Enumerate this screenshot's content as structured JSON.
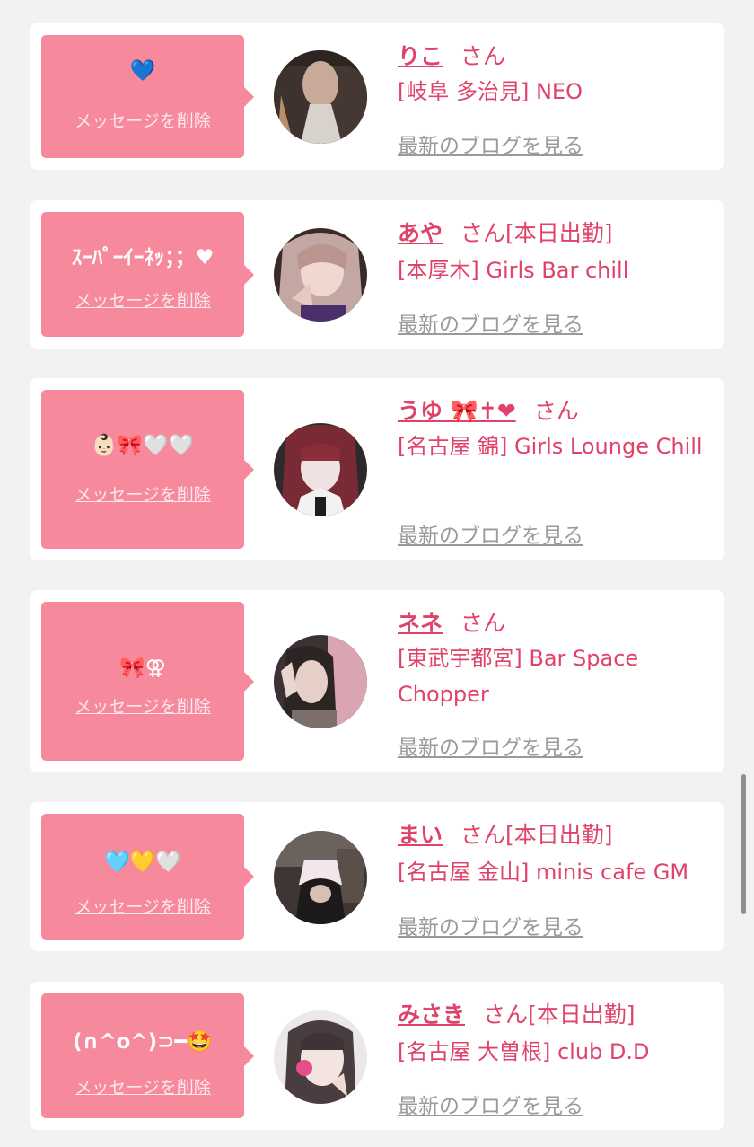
{
  "delete_label": "メッセージを削除",
  "blog_label": "最新のブログを見る",
  "honorific": "さん",
  "items": [
    {
      "name": "りこ",
      "tag": "",
      "message": "💙",
      "shop": "[岐阜 多治見] NEO"
    },
    {
      "name": "あや",
      "tag": "[本日出勤]",
      "message": "ｽｰﾊﾟｰｲｰﾈｯ；；♥",
      "shop": "[本厚木] Girls Bar chill"
    },
    {
      "name": "うゆ 🎀✝❤",
      "tag": "",
      "message": "👶🏻🎀🤍🤍",
      "shop": "[名古屋 錦] Girls Lounge Chill"
    },
    {
      "name": "ネネ",
      "tag": "",
      "message": "🎀⚢",
      "shop": "[東武宇都宮] Bar Space Chopper"
    },
    {
      "name": "まい",
      "tag": "[本日出勤]",
      "message": "🩵💛🤍",
      "shop": "[名古屋 金山] minis cafe GM"
    },
    {
      "name": "みさき",
      "tag": "[本日出勤]",
      "message": "(∩^o^)⊃━🤩",
      "shop": "[名古屋 大曽根] club D.D"
    }
  ],
  "colors": {
    "accent": "#e0436a",
    "bubble": "#f7899d",
    "muted": "#9a9a9a",
    "background": "#f2f2f4"
  }
}
